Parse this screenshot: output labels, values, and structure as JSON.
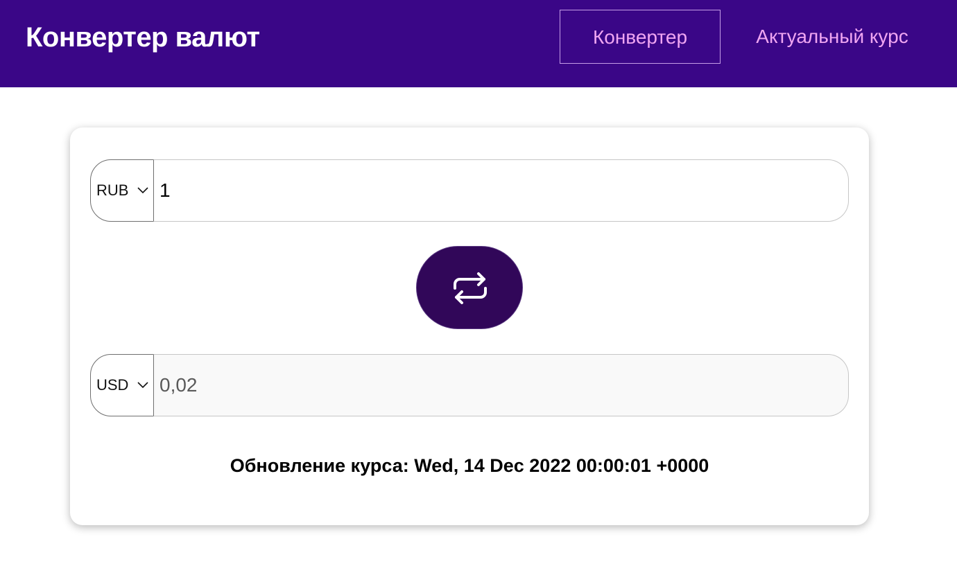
{
  "header": {
    "title": "Конвертер валют",
    "nav": {
      "converter_label": "Конвертер",
      "rate_label": "Актуальный курс"
    }
  },
  "converter": {
    "from": {
      "currency": "RUB",
      "amount": "1"
    },
    "to": {
      "currency": "USD",
      "amount": "0,02"
    },
    "swap_icon": "swap-arrows-icon",
    "update_label": "Обновление курса:",
    "update_time": "Wed, 14 Dec 2022 00:00:01 +0000"
  },
  "colors": {
    "header_bg": "#3a0687",
    "nav_text": "#f0a6f2",
    "swap_bg": "#310759"
  }
}
